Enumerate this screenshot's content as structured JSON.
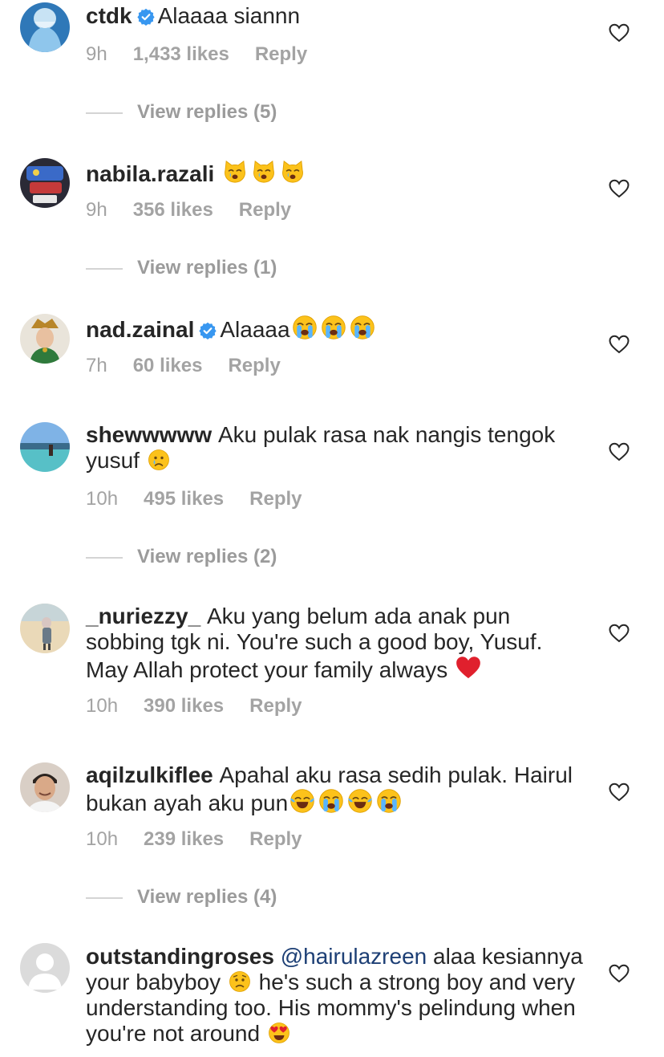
{
  "comments": [
    {
      "username": "ctdk",
      "verified": true,
      "text": "Alaaaa siannn",
      "time": "9h",
      "likes": "1,433 likes",
      "reply": "Reply",
      "view_replies": "View replies (5)"
    },
    {
      "username": "nabila.razali",
      "verified": false,
      "text": "",
      "emojis": [
        "crying-cat-emoji",
        "crying-cat-emoji",
        "crying-cat-emoji"
      ],
      "time": "9h",
      "likes": "356 likes",
      "reply": "Reply",
      "view_replies": "View replies (1)"
    },
    {
      "username": "nad.zainal",
      "verified": true,
      "text": "Alaaaa",
      "emojis": [
        "loudly-crying-emoji",
        "loudly-crying-emoji",
        "loudly-crying-emoji"
      ],
      "time": "7h",
      "likes": "60 likes",
      "reply": "Reply"
    },
    {
      "username": "shewwwww",
      "verified": false,
      "text": "Aku pulak rasa nak nangis tengok yusuf",
      "emojis": [
        "crying-face-emoji"
      ],
      "time": "10h",
      "likes": "495 likes",
      "reply": "Reply",
      "view_replies": "View replies (2)"
    },
    {
      "username": "_nuriezzy_",
      "verified": false,
      "text": "Aku yang belum ada anak pun sobbing tgk ni. You're such a good boy, Yusuf. May Allah protect your family always",
      "emojis": [
        "red-heart-emoji"
      ],
      "time": "10h",
      "likes": "390 likes",
      "reply": "Reply"
    },
    {
      "username": "aqilzulkiflee",
      "verified": false,
      "text": "Apahal aku rasa sedih pulak. Hairul bukan ayah aku pun",
      "emojis": [
        "tears-of-joy-emoji",
        "loudly-crying-emoji",
        "tears-of-joy-emoji",
        "loudly-crying-emoji"
      ],
      "time": "10h",
      "likes": "239 likes",
      "reply": "Reply",
      "view_replies": "View replies (4)"
    },
    {
      "username": "outstandingroses",
      "verified": false,
      "mention": "@hairulazreen",
      "text_part1": "alaa kesiannya your babyboy",
      "text_part2": "he's such a strong boy and very understanding too. His mommy's pelindung when you're not around",
      "emojis": [
        "worried-face-emoji",
        "heart-eyes-emoji"
      ]
    }
  ],
  "colors": {
    "text": "#262626",
    "meta": "#a3a3a3",
    "verified_badge": "#3897f0",
    "mention": "#1d3f75",
    "divider": "#d4d4d4"
  }
}
